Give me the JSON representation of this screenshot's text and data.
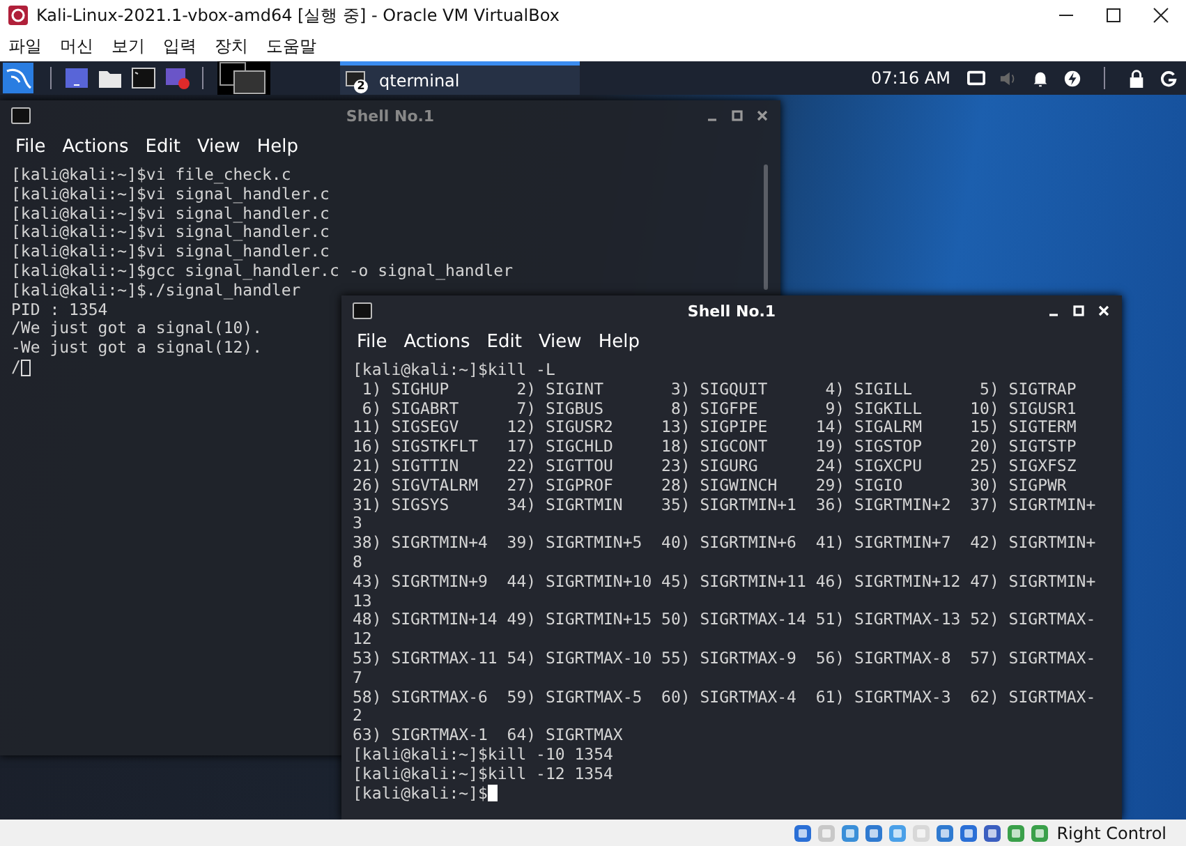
{
  "window": {
    "title": "Kali-Linux-2021.1-vbox-amd64 [실행 중] - Oracle VM VirtualBox"
  },
  "menu": [
    "파일",
    "머신",
    "보기",
    "입력",
    "장치",
    "도움말"
  ],
  "panel": {
    "task": {
      "label": "qterminal",
      "badge": "2",
      "selected": true
    },
    "clock": "07:16 AM"
  },
  "terminals": [
    {
      "title": "Shell No.1",
      "focused": false,
      "menu": [
        "File",
        "Actions",
        "Edit",
        "View",
        "Help"
      ],
      "lines": [
        "[kali@kali:~]$vi file_check.c",
        "[kali@kali:~]$vi signal_handler.c",
        "[kali@kali:~]$vi signal_handler.c",
        "[kali@kali:~]$vi signal_handler.c",
        "[kali@kali:~]$vi signal_handler.c",
        "[kali@kali:~]$gcc signal_handler.c -o signal_handler",
        "[kali@kali:~]$./signal_handler",
        "PID : 1354",
        "/We just got a signal(10).",
        "-We just got a signal(12).",
        "/"
      ]
    },
    {
      "title": "Shell No.1",
      "focused": true,
      "menu": [
        "File",
        "Actions",
        "Edit",
        "View",
        "Help"
      ],
      "lines": [
        "[kali@kali:~]$kill -L",
        " 1) SIGHUP       2) SIGINT       3) SIGQUIT      4) SIGILL       5) SIGTRAP",
        " 6) SIGABRT      7) SIGBUS       8) SIGFPE       9) SIGKILL     10) SIGUSR1",
        "11) SIGSEGV     12) SIGUSR2     13) SIGPIPE     14) SIGALRM     15) SIGTERM",
        "16) SIGSTKFLT   17) SIGCHLD     18) SIGCONT     19) SIGSTOP     20) SIGTSTP",
        "21) SIGTTIN     22) SIGTTOU     23) SIGURG      24) SIGXCPU     25) SIGXFSZ",
        "26) SIGVTALRM   27) SIGPROF     28) SIGWINCH    29) SIGIO       30) SIGPWR",
        "31) SIGSYS      34) SIGRTMIN    35) SIGRTMIN+1  36) SIGRTMIN+2  37) SIGRTMIN+",
        "3",
        "38) SIGRTMIN+4  39) SIGRTMIN+5  40) SIGRTMIN+6  41) SIGRTMIN+7  42) SIGRTMIN+",
        "8",
        "43) SIGRTMIN+9  44) SIGRTMIN+10 45) SIGRTMIN+11 46) SIGRTMIN+12 47) SIGRTMIN+",
        "13",
        "48) SIGRTMIN+14 49) SIGRTMIN+15 50) SIGRTMAX-14 51) SIGRTMAX-13 52) SIGRTMAX-",
        "12",
        "53) SIGRTMAX-11 54) SIGRTMAX-10 55) SIGRTMAX-9  56) SIGRTMAX-8  57) SIGRTMAX-",
        "7",
        "58) SIGRTMAX-6  59) SIGRTMAX-5  60) SIGRTMAX-4  61) SIGRTMAX-3  62) SIGRTMAX-",
        "2",
        "63) SIGRTMAX-1  64) SIGRTMAX",
        "[kali@kali:~]$kill -10 1354",
        "[kali@kali:~]$kill -12 1354",
        "[kali@kali:~]$"
      ]
    }
  ],
  "status_bar": {
    "host_key": "Right Control"
  }
}
